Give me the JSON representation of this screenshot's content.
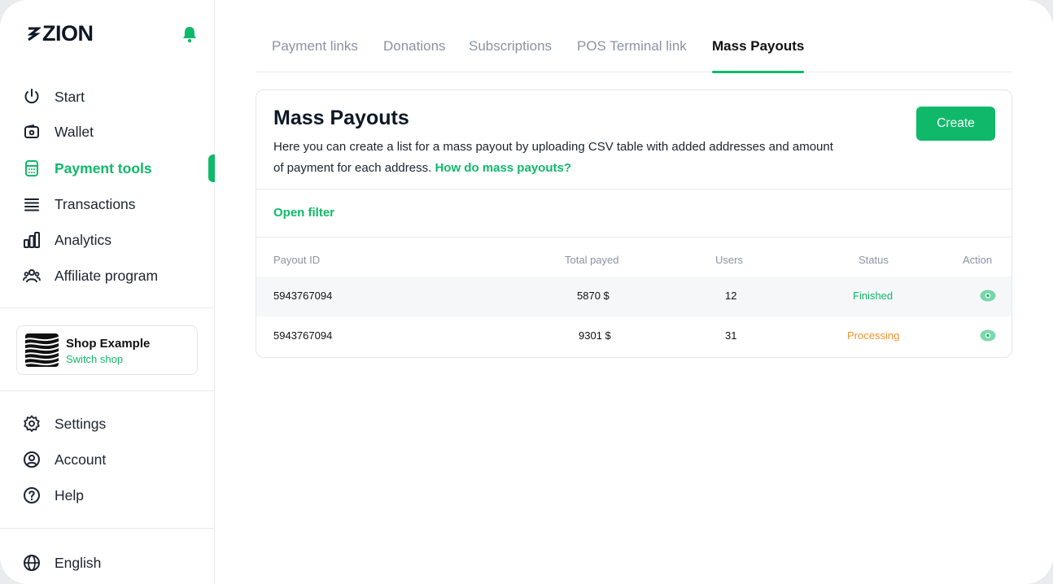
{
  "brand": {
    "name": "ZION"
  },
  "sidebar": {
    "items": [
      {
        "label": "Start",
        "icon": "power-icon"
      },
      {
        "label": "Wallet",
        "icon": "wallet-icon"
      },
      {
        "label": "Payment tools",
        "icon": "calculator-icon",
        "active": true
      },
      {
        "label": "Transactions",
        "icon": "list-icon"
      },
      {
        "label": "Analytics",
        "icon": "bar-chart-icon"
      },
      {
        "label": "Affiliate program",
        "icon": "users-icon"
      }
    ],
    "shop": {
      "name": "Shop Example",
      "switch_label": "Switch shop"
    },
    "bottom_items": [
      {
        "label": "Settings",
        "icon": "gear-icon"
      },
      {
        "label": "Account",
        "icon": "user-circle-icon"
      },
      {
        "label": "Help",
        "icon": "help-icon"
      }
    ],
    "language": {
      "label": "English",
      "icon": "globe-icon"
    }
  },
  "tabs": [
    {
      "label": "Payment links"
    },
    {
      "label": "Donations"
    },
    {
      "label": "Subscriptions"
    },
    {
      "label": "POS Terminal link"
    },
    {
      "label": "Mass Payouts",
      "active": true
    }
  ],
  "card": {
    "title": "Mass Payouts",
    "description": "Here you can create a list for a mass payout by uploading CSV table with added addresses and amount of payment for each address.",
    "help_link": "How do mass payouts?",
    "create_label": "Create",
    "filter_label": "Open filter"
  },
  "table": {
    "columns": [
      "Payout ID",
      "Total payed",
      "Users",
      "Status",
      "Action"
    ],
    "rows": [
      {
        "id": "5943767094",
        "total": "5870 $",
        "users": "12",
        "status": "Finished"
      },
      {
        "id": "5943767094",
        "total": "9301 $",
        "users": "31",
        "status": "Processing"
      }
    ]
  },
  "colors": {
    "accent": "#10b96a",
    "finished": "#10b96a",
    "processing": "#f0932b",
    "muted": "#8a93a3"
  }
}
